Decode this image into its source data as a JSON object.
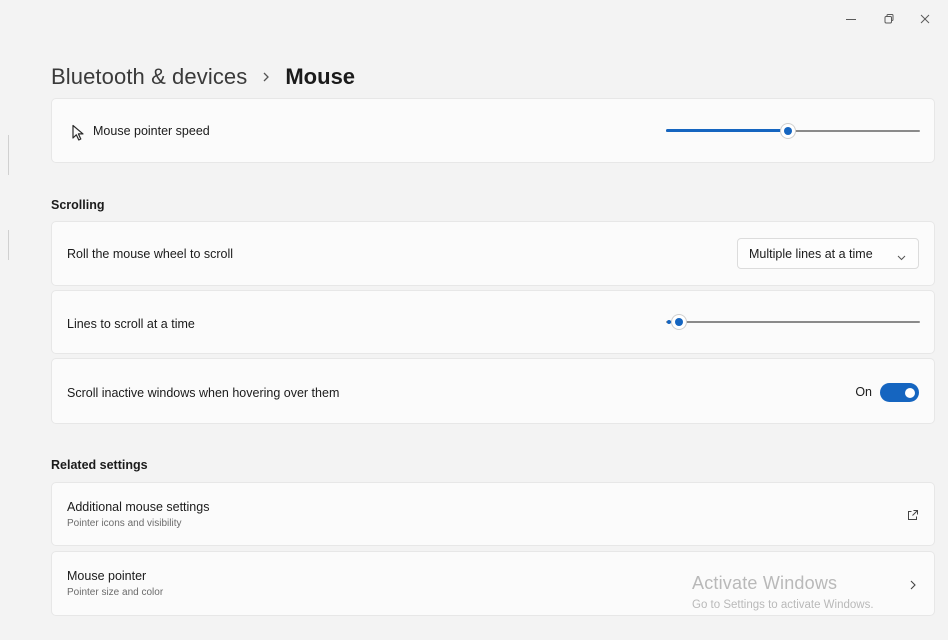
{
  "window": {
    "controls": {
      "minimize_icon": "minimize-icon",
      "maximize_icon": "restore-icon",
      "close_icon": "close-icon"
    }
  },
  "breadcrumb": {
    "parent": "Bluetooth & devices",
    "separator_icon": "chevron-right-icon",
    "current": "Mouse"
  },
  "pointer_speed": {
    "icon": "mouse-pointer-icon",
    "label": "Mouse pointer speed",
    "value_fraction": 0.48
  },
  "scrolling": {
    "title": "Scrolling",
    "wheel": {
      "label": "Roll the mouse wheel to scroll",
      "selected": "Multiple lines at a time",
      "chevron_icon": "chevron-down-icon"
    },
    "lines": {
      "label": "Lines to scroll at a time",
      "value_fraction": 0.05
    },
    "inactive": {
      "label": "Scroll inactive windows when hovering over them",
      "state": "On",
      "enabled": true
    }
  },
  "related": {
    "title": "Related settings",
    "items": [
      {
        "title": "Additional mouse settings",
        "subtitle": "Pointer icons and visibility",
        "icon": "open-external-icon"
      },
      {
        "title": "Mouse pointer",
        "subtitle": "Pointer size and color",
        "icon": "chevron-right-icon"
      }
    ]
  },
  "watermark": {
    "line1": "Activate Windows",
    "line2": "Go to Settings to activate Windows."
  },
  "colors": {
    "accent": "#1565c0",
    "background": "#f3f3f3",
    "card": "#fbfbfb"
  }
}
